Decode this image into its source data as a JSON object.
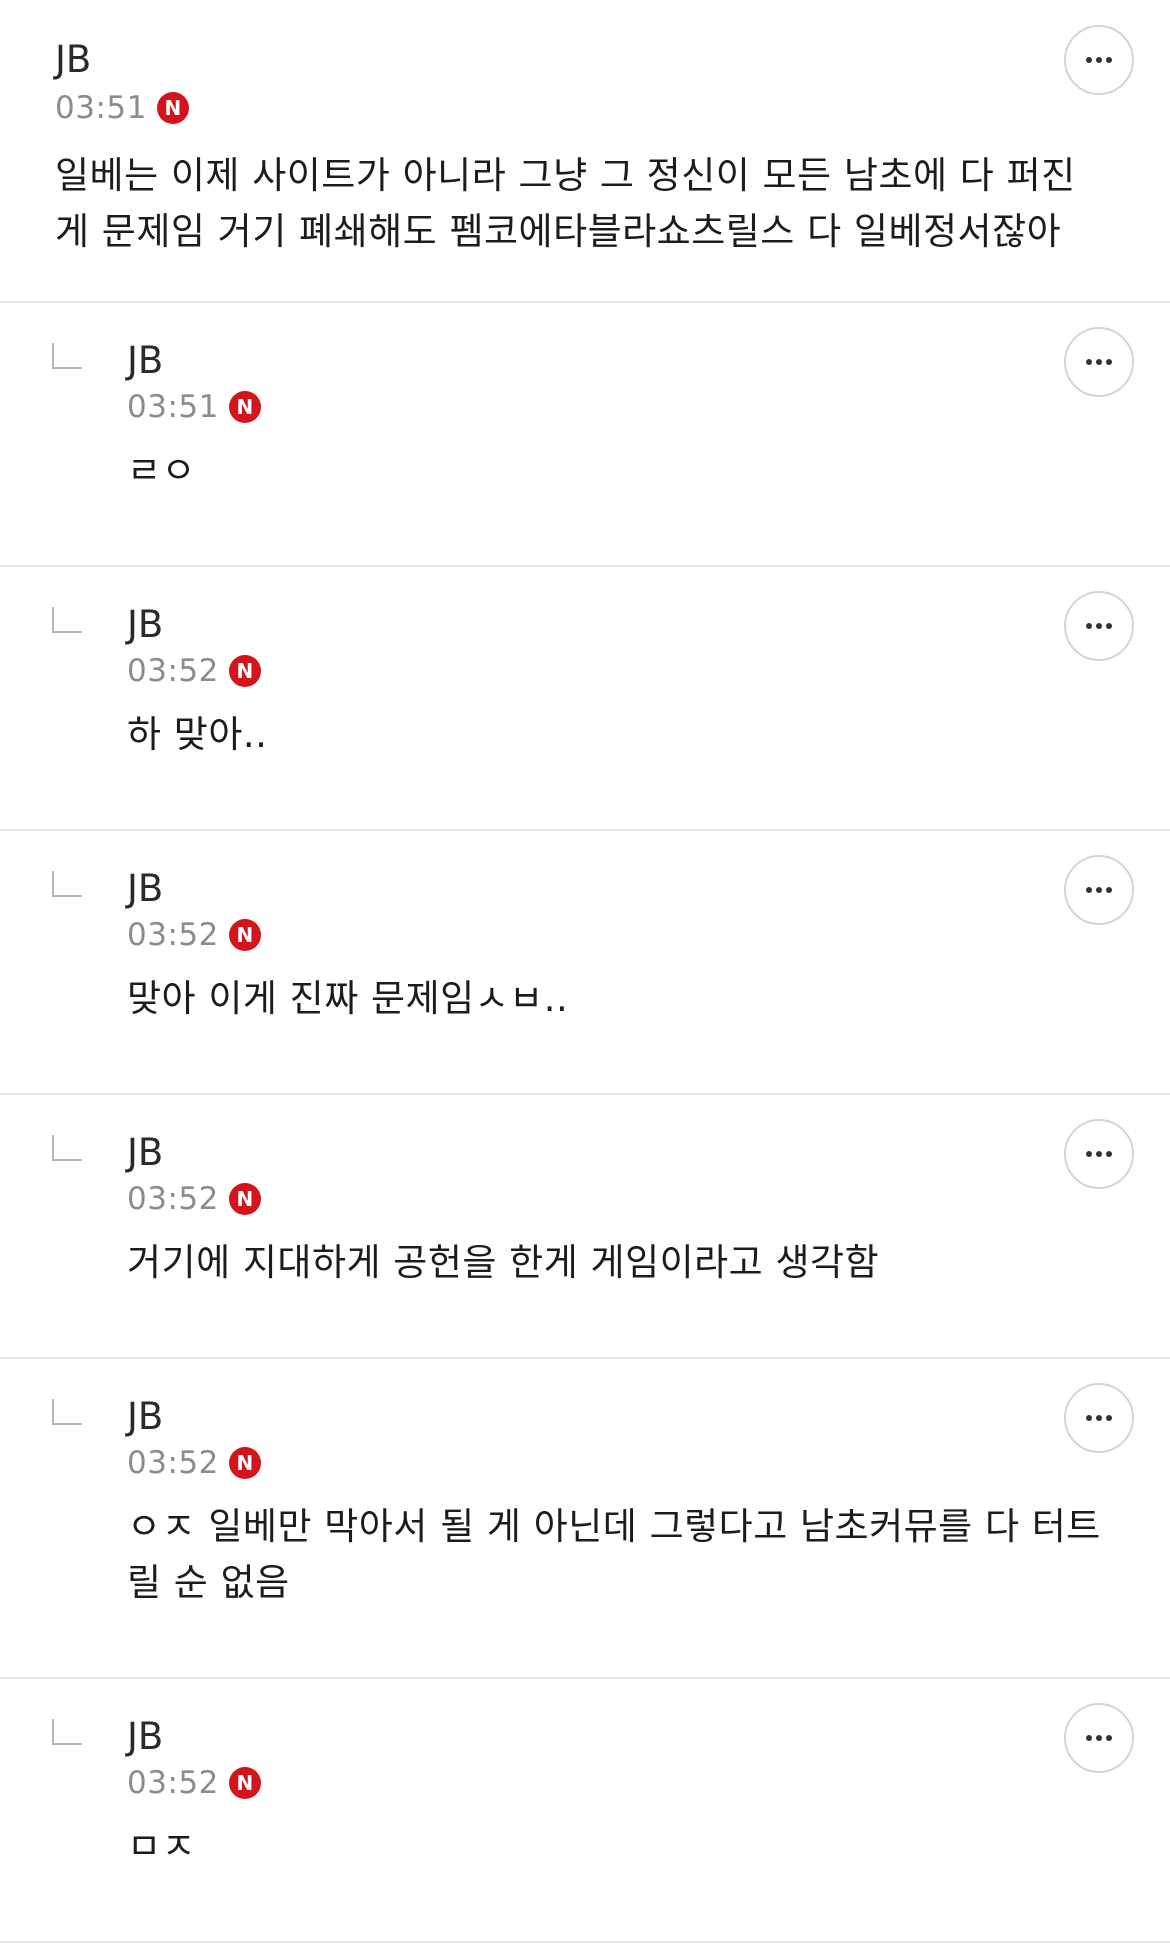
{
  "comments": [
    {
      "author": "JB",
      "time": "03:51",
      "badge": "N",
      "text": "일베는 이제 사이트가 아니라 그냥 그 정신이 모든 남초에 다 퍼진 게 문제임 거기 폐쇄해도 펨코에타블라쇼츠릴스 다 일베정서잖아"
    },
    {
      "author": "JB",
      "time": "03:51",
      "badge": "N",
      "text": "ㄹㅇ"
    },
    {
      "author": "JB",
      "time": "03:52",
      "badge": "N",
      "text": "하 맞아.."
    },
    {
      "author": "JB",
      "time": "03:52",
      "badge": "N",
      "text": "맞아 이게 진짜 문제임ㅅㅂ.."
    },
    {
      "author": "JB",
      "time": "03:52",
      "badge": "N",
      "text": "거기에 지대하게 공헌을 한게 게임이라고 생각함"
    },
    {
      "author": "JB",
      "time": "03:52",
      "badge": "N",
      "text": "ㅇㅈ 일베만 막아서 될 게 아닌데 그렇다고 남초커뮤를 다 터트릴 순 없음"
    },
    {
      "author": "JB",
      "time": "03:52",
      "badge": "N",
      "text": "ㅁㅈ"
    }
  ],
  "icons": {
    "more": "more-horizontal-icon",
    "reply": "reply-arrow-icon"
  },
  "colors": {
    "badge": "#d4141c",
    "time": "#8c8c8c",
    "divider": "#e6e6e6"
  }
}
